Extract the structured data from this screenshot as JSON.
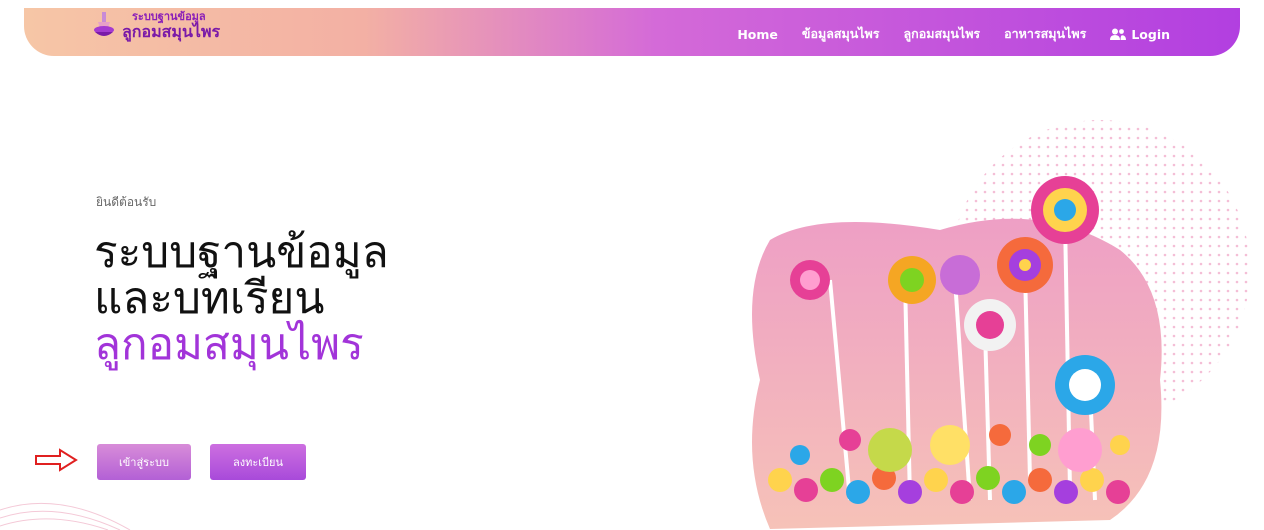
{
  "brand": {
    "line1": "ระบบฐานข้อมูล",
    "line2": "ลูกอมสมุนไพร"
  },
  "nav": {
    "items": [
      "Home",
      "ข้อมูลสมุนไพร",
      "ลูกอมสมุนไพร",
      "อาหารสมุนไพร"
    ],
    "login_label": "Login"
  },
  "hero": {
    "welcome": "ยินดีต้อนรับ",
    "title_line1": "ระบบฐานข้อมูล",
    "title_line2": "และบทเรียน",
    "title_line3": "ลูกอมสมุนไพร",
    "login_button": "เข้าสู่ระบบ",
    "register_button": "ลงทะเบียน"
  },
  "colors": {
    "accent": "#a234d9",
    "nav_gradient_start": "#f6c6a6",
    "nav_gradient_end": "#b23fe0",
    "arrow": "#e02020"
  },
  "icons": [
    "logo-icon",
    "user-group-icon",
    "arrow-right-icon"
  ]
}
